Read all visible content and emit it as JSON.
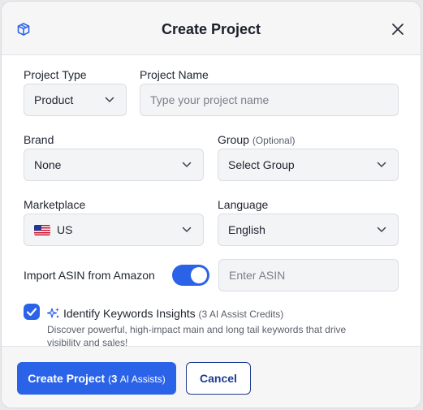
{
  "modal": {
    "title": "Create Project",
    "logo_icon": "cube-icon",
    "close_icon": "close-icon"
  },
  "form": {
    "project_type": {
      "label": "Project Type",
      "value": "Product"
    },
    "project_name": {
      "label": "Project Name",
      "placeholder": "Type your project name",
      "value": ""
    },
    "brand": {
      "label": "Brand",
      "value": "None"
    },
    "group": {
      "label": "Group",
      "optional": "(Optional)",
      "value": "Select Group"
    },
    "marketplace": {
      "label": "Marketplace",
      "value": "US",
      "flag_icon": "us-flag-icon"
    },
    "language": {
      "label": "Language",
      "value": "English"
    },
    "import_asin": {
      "label": "Import ASIN from Amazon",
      "enabled": true,
      "placeholder": "Enter ASIN",
      "value": ""
    },
    "keywords": {
      "checked": true,
      "title": "Identify Keywords Insights",
      "credits": "(3 AI Assist Credits)",
      "description": "Discover powerful, high-impact main and long tail keywords that drive visibility and sales!"
    }
  },
  "footer": {
    "create_label": "Create Project",
    "create_sub_open": "(",
    "create_sub_count": "3",
    "create_sub_text": "AI Assists)",
    "cancel_label": "Cancel"
  },
  "colors": {
    "accent": "#2b63e8",
    "cancel_border": "#1f3b8f"
  }
}
